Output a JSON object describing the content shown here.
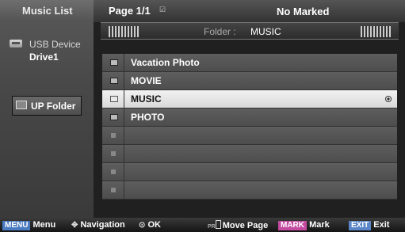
{
  "sidebar": {
    "title": "Music List",
    "device_label": "USB Device",
    "drive_label": "Drive1",
    "up_folder_label": "UP Folder"
  },
  "header": {
    "page_label": "Page 1/1",
    "marked_label": "No Marked"
  },
  "folder_bar": {
    "caption": "Folder :",
    "name": "MUSIC"
  },
  "files": [
    {
      "name": "Vacation Photo",
      "type": "folder"
    },
    {
      "name": "MOVIE",
      "type": "folder"
    },
    {
      "name": "MUSIC",
      "type": "folder",
      "selected": true
    },
    {
      "name": "PHOTO",
      "type": "folder"
    },
    {
      "name": "",
      "type": "empty"
    },
    {
      "name": "",
      "type": "empty"
    },
    {
      "name": "",
      "type": "empty"
    },
    {
      "name": "",
      "type": "empty"
    }
  ],
  "footer": {
    "menu_key": "MENU",
    "menu_label": "Menu",
    "nav_label": "Navigation",
    "ok_label": "OK",
    "pr_text": "PR",
    "move_page_label": "Move Page",
    "mark_key": "MARK",
    "mark_label": "Mark",
    "exit_key": "EXIT",
    "exit_label": "Exit"
  },
  "colors": {
    "key_blue": "#4a7ac0",
    "key_pink": "#c44aa0",
    "selected_row": "#e8e8e8"
  }
}
